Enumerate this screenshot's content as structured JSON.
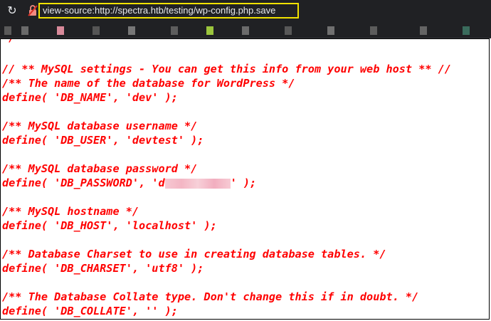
{
  "browser": {
    "address_bar_text": "view-source:http://spectra.htb/testing/wp-config.php.save",
    "reload_icon": "↻",
    "colors": {
      "chrome": "#202124",
      "highlight_border": "#f1e200",
      "text": "#e8eaed"
    }
  },
  "source": {
    "color": "#ff0000",
    "lines": [
      "*/",
      "",
      "// ** MySQL settings - You can get this info from your web host ** //",
      "/** The name of the database for WordPress */",
      "define( 'DB_NAME', 'dev' );",
      "",
      "/** MySQL database username */",
      "define( 'DB_USER', 'devtest' );",
      "",
      "/** MySQL database password */",
      "",
      "",
      "/** MySQL hostname */",
      "define( 'DB_HOST', 'localhost' );",
      "",
      "/** Database Charset to use in creating database tables. */",
      "define( 'DB_CHARSET', 'utf8' );",
      "",
      "/** The Database Collate type. Don't change this if in doubt. */",
      "define( 'DB_COLLATE', '' );"
    ],
    "password_line": {
      "prefix": "define( 'DB_PASSWORD', 'd",
      "suffix": "' );"
    }
  }
}
